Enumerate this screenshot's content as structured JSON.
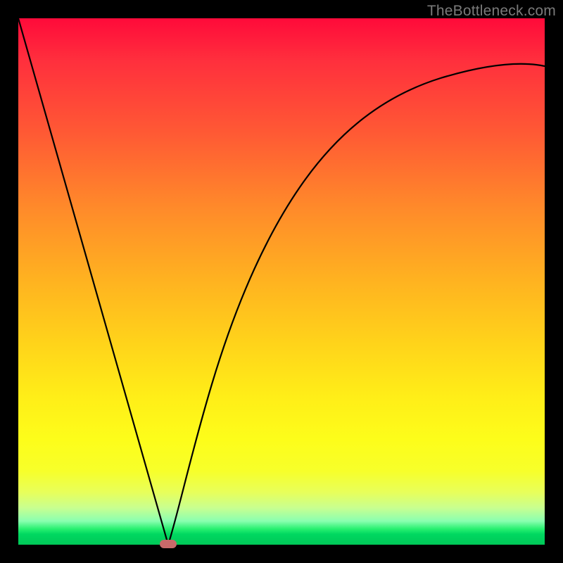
{
  "watermark": "TheBottleneck.com",
  "colors": {
    "frame": "#000000",
    "curve": "#000000",
    "marker": "#c86a6a"
  },
  "chart_data": {
    "type": "line",
    "title": "",
    "xlabel": "",
    "ylabel": "",
    "xlim": [
      0,
      100
    ],
    "ylim": [
      0,
      100
    ],
    "grid": false,
    "legend": false,
    "note": "No axis ticks or numeric labels are rendered; values are read from relative position in the plot area.",
    "series": [
      {
        "name": "left-branch",
        "x": [
          0,
          5,
          10,
          15,
          20,
          25,
          27,
          28.5
        ],
        "y": [
          100,
          82,
          65,
          47,
          29,
          12,
          5,
          0
        ]
      },
      {
        "name": "right-branch",
        "x": [
          28.5,
          30,
          32,
          35,
          40,
          45,
          50,
          55,
          60,
          65,
          70,
          75,
          80,
          85,
          90,
          95,
          100
        ],
        "y": [
          0,
          8,
          18,
          30,
          44,
          54,
          62,
          68,
          73,
          77,
          80,
          83,
          85,
          87,
          88.5,
          90,
          91
        ]
      }
    ],
    "marker": {
      "x": 28.5,
      "y": 0,
      "shape": "pill"
    },
    "background_gradient": {
      "top": "#ff0a3a",
      "mid": "#ffd41a",
      "bottom": "#00c858"
    }
  }
}
